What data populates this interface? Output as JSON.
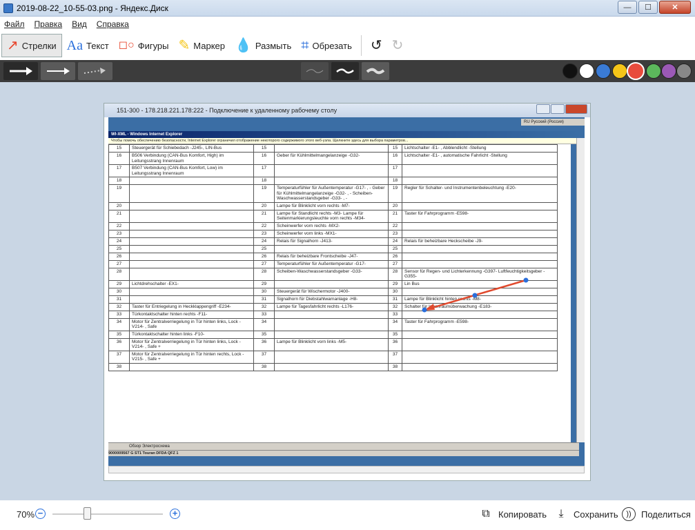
{
  "window": {
    "title": "2019-08-22_10-55-03.png - Яндекс.Диск",
    "minimize": "—",
    "maximize": "☐",
    "close": "✕"
  },
  "menu": [
    "Файл",
    "Правка",
    "Вид",
    "Справка"
  ],
  "tools": [
    {
      "label": "Стрелки",
      "icon": "arrow-icon",
      "active": true
    },
    {
      "label": "Текст",
      "icon": "text-icon",
      "active": false
    },
    {
      "label": "Фигуры",
      "icon": "shapes-icon",
      "active": false
    },
    {
      "label": "Маркер",
      "icon": "marker-icon",
      "active": false
    },
    {
      "label": "Размыть",
      "icon": "blur-drop-icon",
      "active": false
    },
    {
      "label": "Обрезать",
      "icon": "crop-icon",
      "active": false
    }
  ],
  "colors": [
    "#111111",
    "#ffffff",
    "#3a7bd5",
    "#f5c518",
    "#e84b3c",
    "#5cb85c",
    "#9b59b6",
    "#888888"
  ],
  "selected_color": "#e84b3c",
  "remote": {
    "rdp_title": "151-300 - 178.218.221.178:222 - Подключение к удаленному рабочему столу",
    "lang": "RU Русский (Россия)",
    "ie_title": "WI-XML - Windows Internet Explorer",
    "ie_info": "Чтобы помочь обеспечению безопасности, Internet Explorer ограничил отображение некоторого содержимого этого веб-узла. Щелкните здесь для выбора параметров...",
    "rows": [
      [
        "15",
        "Steuergerät für Schiebedach -J245-, LIN-Bus",
        "15",
        "",
        "15",
        "Lichtschalter -E1- , Abblendlicht -Stellung"
      ],
      [
        "16",
        "B506 Verbindung (CAN-Bus Komfort, High) im Leitungsstrang Innenraum",
        "16",
        "Geber für Kühlmittelmangelanzeige -G32-",
        "16",
        "Lichtschalter -E1- , automatische Fahrlicht -Stellung"
      ],
      [
        "17",
        "B507 Verbindung (CAN-Bus Komfort, Low) im Leitungsstrang Innenraum",
        "17",
        "",
        "17",
        ""
      ],
      [
        "18",
        "",
        "18",
        "",
        "18",
        ""
      ],
      [
        "19",
        "",
        "19",
        "Temperaturfühler für Außentemperatur -G17- , - Geber für Kühlmittelmangelanzeige -G32- , - Scheiben-Waschwasserstandsgeber -G33- , -",
        "19",
        "Regler für Schalter- und Instrumentenbeleuchtung -E20-"
      ],
      [
        "20",
        "",
        "20",
        "Lampe für Blinklicht vorn rechts -M7-",
        "20",
        ""
      ],
      [
        "21",
        "",
        "21",
        "Lampe für Standlicht rechts -M3- Lampe für Seitenmarkierungsleuchte vorn rechts -M34-",
        "21",
        "Taster für Fahrprogramm -E598-"
      ],
      [
        "22",
        "",
        "22",
        "Scheinwerfer vorn rechts -MX2-",
        "22",
        ""
      ],
      [
        "23",
        "",
        "23",
        "Scheinwerfer vorn links -MX1-",
        "23",
        ""
      ],
      [
        "24",
        "",
        "24",
        "Relais für Signalhorn -J413-",
        "24",
        "Relais für beheizbare Heckscheibe -J9-"
      ],
      [
        "25",
        "",
        "25",
        "",
        "25",
        ""
      ],
      [
        "26",
        "",
        "26",
        "Relais für beheizbare Frontscheibe -J47-",
        "26",
        ""
      ],
      [
        "27",
        "",
        "27",
        "Temperaturfühler für Außentemperatur -G17-",
        "27",
        ""
      ],
      [
        "28",
        "",
        "28",
        "Scheiben-Waschwasserstandsgeber -G33-",
        "28",
        "Sensor für Regen- und Lichterkennung -G397- Luftfeuchtigkeitsgeber -G355-"
      ],
      [
        "29",
        "Lichtdrehschalter -EX1-",
        "29",
        "",
        "29",
        "Lin Bus"
      ],
      [
        "30",
        "",
        "30",
        "Steuergerät für Wischermotor -J400-",
        "30",
        ""
      ],
      [
        "31",
        "",
        "31",
        "Signalhorn für Diebstahlwarnanlage -H8-",
        "31",
        "Lampe für Blinklicht hinten rechts -M8-"
      ],
      [
        "32",
        "Taster für Entriegelung in Heckklappengriff -E234-",
        "32",
        "Lampe für Tagesfahrlicht rechts -L176-",
        "32",
        "Schalter für Innenraumüberwachung -E183-"
      ],
      [
        "33",
        "Türkontaktschalter hinten rechts -F11-",
        "33",
        "",
        "33",
        ""
      ],
      [
        "34",
        "Motor für Zentralverriegelung in Tür hinten links, Lock -V214- , Safe",
        "34",
        "",
        "34",
        "Taster für Fahrprogramm -E598-"
      ],
      [
        "35",
        "Türkontaktschalter hinten links -F10-",
        "35",
        "",
        "35",
        ""
      ],
      [
        "36",
        "Motor für Zentralverriegelung in Tür hinten links, Lock -V214- , Safe +",
        "36",
        "Lampe für Blinklicht vorn links -M5-",
        "36",
        ""
      ],
      [
        "37",
        "Motor für Zentralverriegelung in Tür hinten rechts, Lock -V215- , Safe +",
        "37",
        "",
        "37",
        ""
      ],
      [
        "38",
        "",
        "38",
        "",
        "38",
        ""
      ]
    ],
    "sheet_tabs": "Обзор  Электросхема",
    "status": "9000009567          G  ST1  Touran  DFDA  QFZ                                   1"
  },
  "bottom": {
    "zoom": "70%",
    "zoom_out": "−",
    "zoom_in": "+",
    "copy": "Копировать",
    "save": "Сохранить",
    "share": "Поделиться"
  }
}
